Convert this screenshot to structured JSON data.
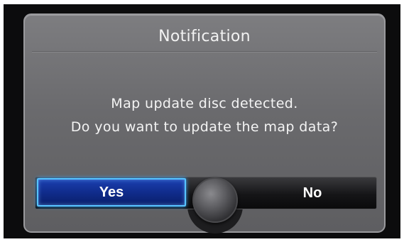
{
  "dialog": {
    "title": "Notification",
    "message_lines": [
      "Map update disc detected.",
      "Do you want to update the map data?"
    ],
    "buttons": {
      "yes_label": "Yes",
      "no_label": "No"
    },
    "selected_button": "Yes"
  },
  "colors": {
    "selected_button_fill": "#102c8c",
    "selected_button_border": "#57c3ff",
    "dialog_background": "#6a6a6d",
    "screen_background": "#0c0c0d"
  },
  "icons": {
    "control_knob": "selector-knob-icon"
  }
}
